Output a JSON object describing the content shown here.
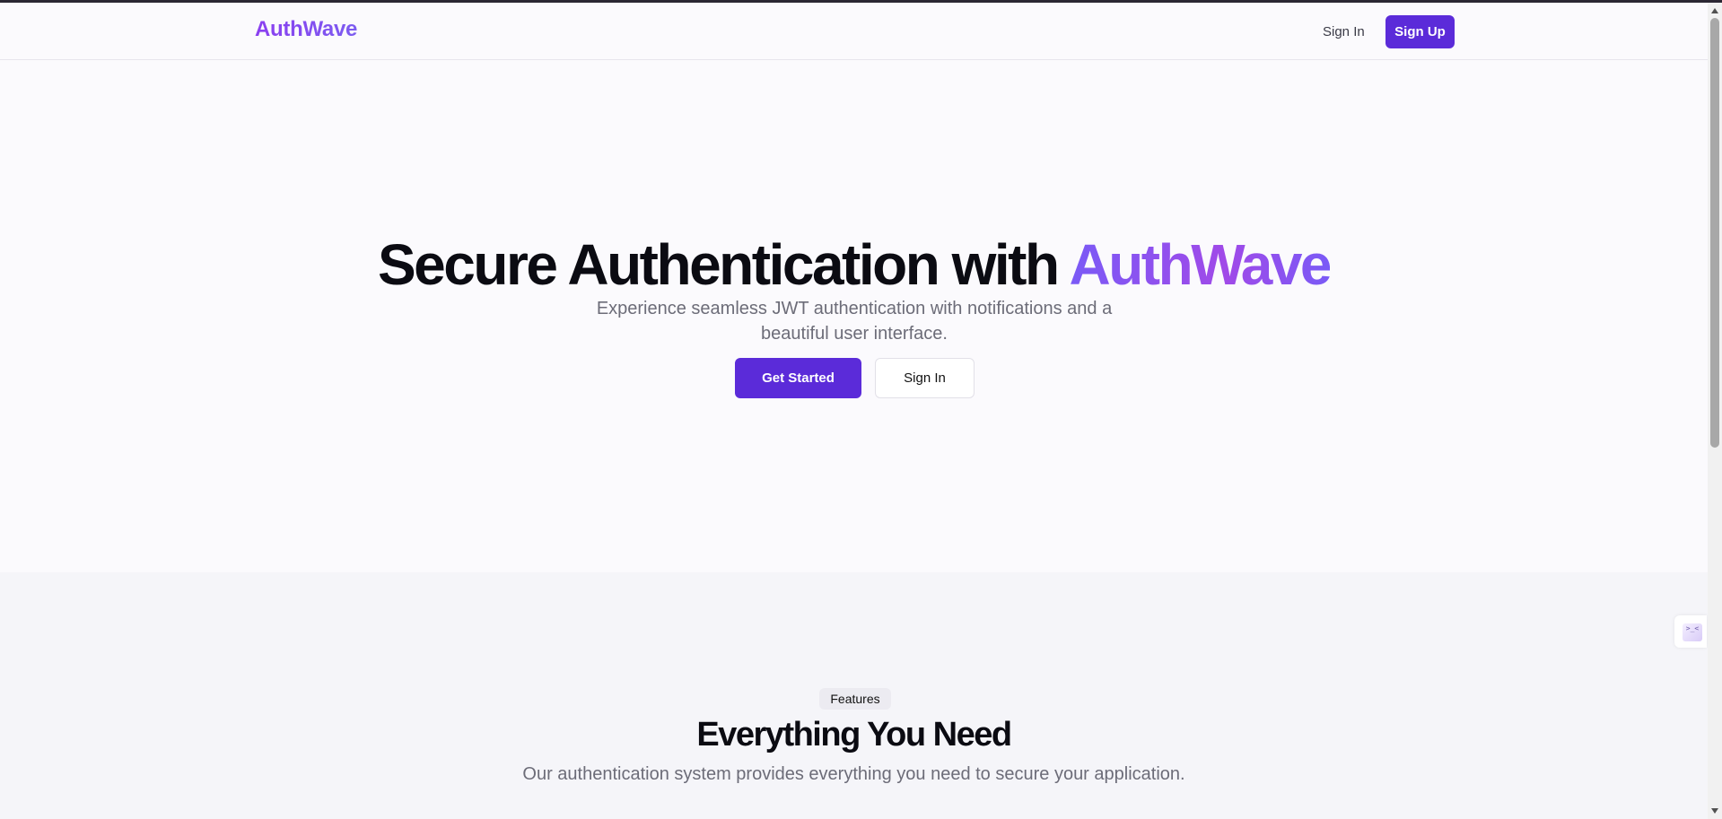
{
  "header": {
    "brand": "AuthWave",
    "nav_signin": "Sign In",
    "nav_signup": "Sign Up"
  },
  "hero": {
    "title_main": "Secure Authentication with",
    "title_accent": "AuthWave",
    "subtitle": "Experience seamless JWT authentication with notifications and a beautiful user interface.",
    "cta_primary": "Get Started",
    "cta_secondary": "Sign In"
  },
  "features": {
    "badge": "Features",
    "title": "Everything You Need",
    "subtitle": "Our authentication system provides everything you need to secure your application."
  },
  "side_widget": {
    "glyph": ">_<",
    "icon": "devtools-icon"
  },
  "colors": {
    "primary": "#5b2bd9",
    "accent_gradient_start": "#7a5af6",
    "accent_gradient_end": "#a04ae8",
    "background": "#fbfafd",
    "features_background": "#f5f5f9",
    "muted_text": "#6c6c78"
  }
}
